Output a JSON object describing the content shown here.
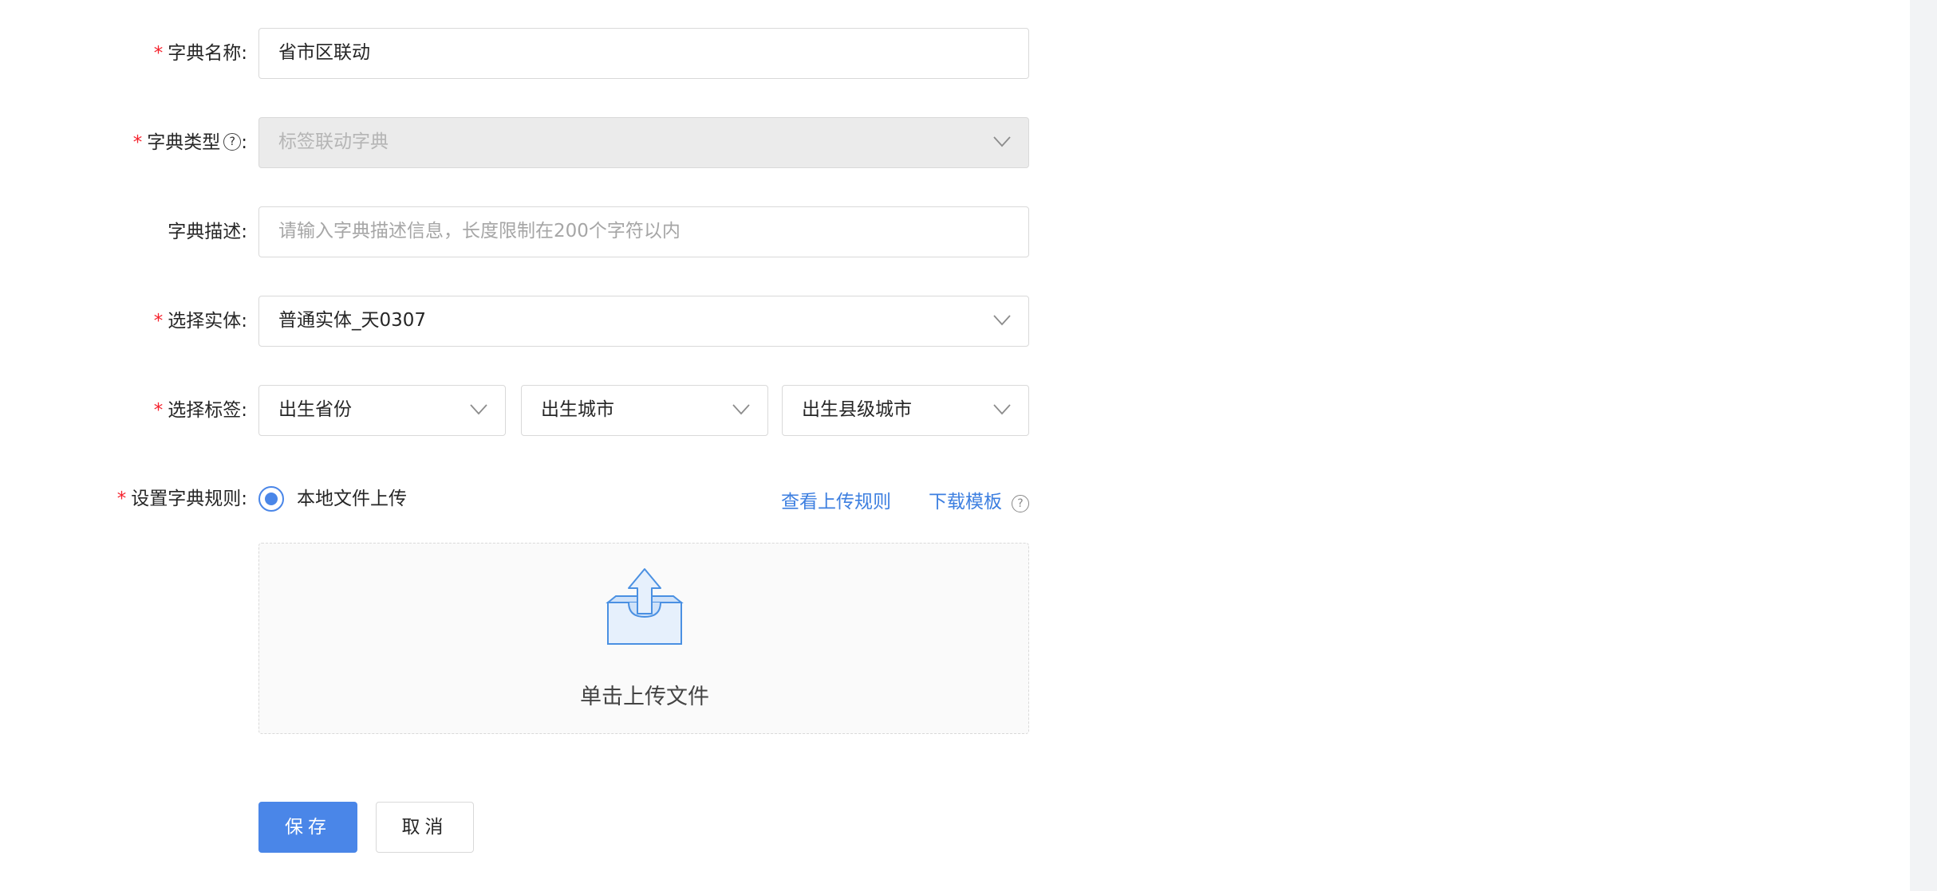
{
  "form": {
    "dict_name": {
      "label": "字典名称:",
      "required_mark": "*",
      "value": "省市区联动"
    },
    "dict_type": {
      "label": "字典类型",
      "label_suffix": ":",
      "required_mark": "*",
      "help_icon": "question-circle-icon",
      "value": "标签联动字典",
      "disabled": true
    },
    "dict_desc": {
      "label": "字典描述:",
      "placeholder": "请输入字典描述信息，长度限制在200个字符以内"
    },
    "entity": {
      "label": "选择实体:",
      "required_mark": "*",
      "value": "普通实体_天0307"
    },
    "tags": {
      "label": "选择标签:",
      "required_mark": "*",
      "values": [
        "出生省份",
        "出生城市",
        "出生县级城市"
      ]
    },
    "rule": {
      "label": "设置字典规则:",
      "required_mark": "*",
      "option_label": "本地文件上传",
      "view_rules_link": "查看上传规则",
      "download_link": "下载模板",
      "upload_text": "单击上传文件"
    }
  },
  "buttons": {
    "save": "保存",
    "cancel": "取消"
  },
  "colors": {
    "primary": "#4a86e8",
    "link": "#3d7fe0",
    "required": "#f5222d",
    "border": "#d9d9d9",
    "disabled_bg": "#ebebeb"
  }
}
